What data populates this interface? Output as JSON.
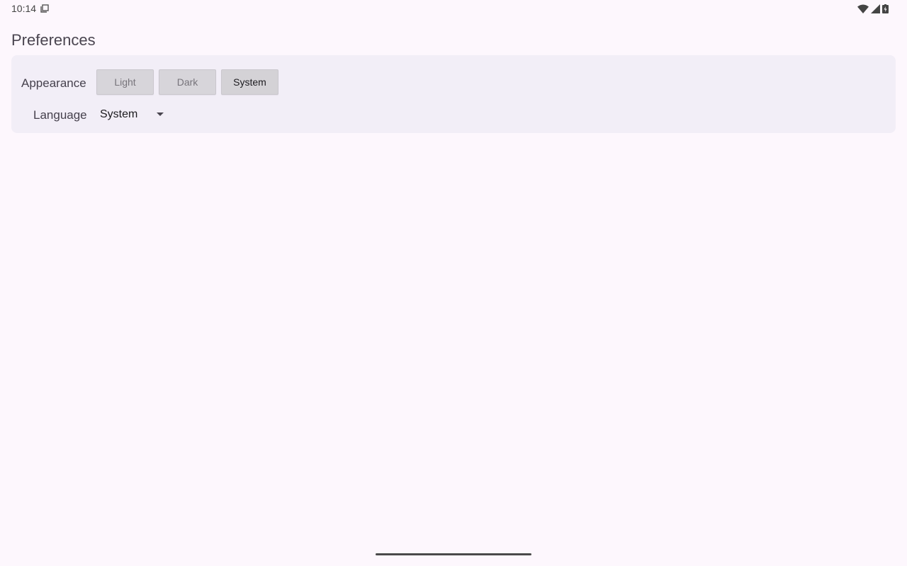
{
  "status_bar": {
    "time": "10:14",
    "icons": [
      "screen-icon",
      "wifi-icon",
      "cellular-signal-icon",
      "battery-charging-icon"
    ]
  },
  "page": {
    "title": "Preferences"
  },
  "appearance": {
    "label": "Appearance",
    "options": [
      "Light",
      "Dark",
      "System"
    ],
    "selected": "System"
  },
  "language": {
    "label": "Language",
    "value": "System"
  },
  "colors": {
    "background": "#fdf7fd",
    "card": "#f2eef7",
    "button": "#d7d5da"
  }
}
